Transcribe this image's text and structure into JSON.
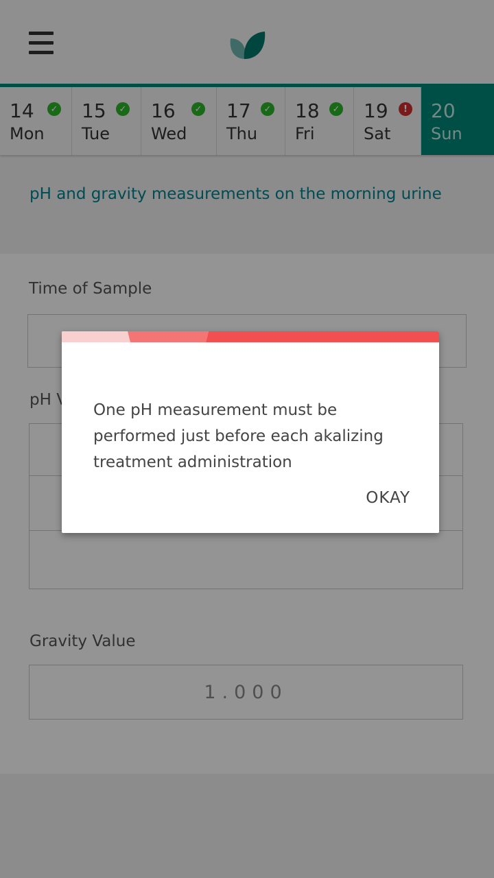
{
  "header": {
    "menu_icon": "hamburger-menu-icon",
    "logo_icon": "leaf-logo-icon"
  },
  "days": [
    {
      "num": "14",
      "name": "Mon",
      "status": "ok"
    },
    {
      "num": "15",
      "name": "Tue",
      "status": "ok"
    },
    {
      "num": "16",
      "name": "Wed",
      "status": "ok"
    },
    {
      "num": "17",
      "name": "Thu",
      "status": "ok"
    },
    {
      "num": "18",
      "name": "Fri",
      "status": "ok"
    },
    {
      "num": "19",
      "name": "Sat",
      "status": "error"
    },
    {
      "num": "20",
      "name": "Sun",
      "status": "active"
    }
  ],
  "section": {
    "title": "pH and gravity measurements on the morning urine"
  },
  "form": {
    "time_label": "Time of Sample",
    "ph_label": "pH V",
    "gravity_label": "Gravity Value",
    "gravity_value": "1.000"
  },
  "dialog": {
    "message": "One pH measurement must be performed just before each akalizing treatment administration",
    "ok_label": "OKAY"
  },
  "colors": {
    "accent": "#00897b",
    "title_teal": "#00838f",
    "check_green": "#2bb52b",
    "error_red": "#d32f2f",
    "dialog_bar_light": "#f9d0d0",
    "dialog_bar_mid": "#f57575",
    "dialog_bar_dark": "#f24f50"
  }
}
